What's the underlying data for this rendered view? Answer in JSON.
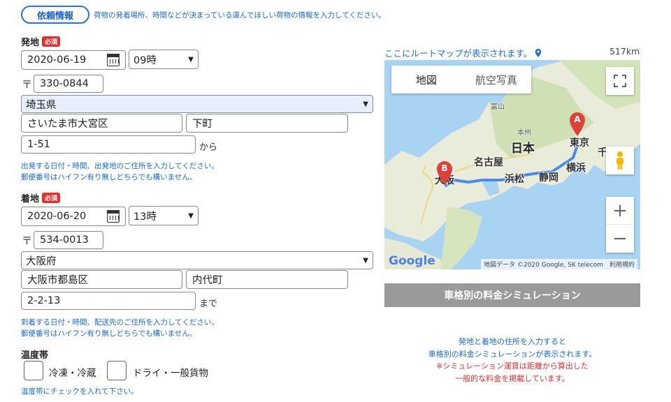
{
  "tab": {
    "label": "依頼情報"
  },
  "intro": "荷物の発着場所、時間などが決まっている運んでほしい荷物の情報を入力してください。",
  "required_badge": "必須",
  "postal_mark": "〒",
  "departure": {
    "label": "発地",
    "date": "2020-06-19",
    "time": "09時",
    "postal": "330-0844",
    "prefecture": "埼玉県",
    "city": "さいたま市大宮区",
    "town": "下町",
    "address": "1-51",
    "suffix": "から",
    "note1": "出発する日付・時間、出発地のご住所を入力してください。",
    "note2": "郵便番号はハイフン有り無しどちらでも構いません。"
  },
  "arrival": {
    "label": "着地",
    "date": "2020-06-20",
    "time": "13時",
    "postal": "534-0013",
    "prefecture": "大阪府",
    "city": "大阪市都島区",
    "town": "内代町",
    "address": "2-2-13",
    "suffix": "まで",
    "note1": "到着する日付・時間、配送先のご住所を入力してください。",
    "note2": "郵便番号はハイフン有り無しどちらでも構いません。"
  },
  "temperature": {
    "label": "温度帯",
    "option1": "冷凍・冷蔵",
    "option2": "ドライ・一般貨物",
    "note": "温度帯にチェックを入れて下さい。"
  },
  "map": {
    "caption": "ここにルートマップが表示されます。",
    "distance": "517km",
    "tab_map": "地図",
    "tab_satellite": "航空写真",
    "zoom_in": "+",
    "zoom_out": "−",
    "marker_a": "A",
    "marker_b": "B",
    "labels": {
      "japan": "日本",
      "tokyo": "東京",
      "yokohama": "横浜",
      "chiba": "千",
      "nagoya": "名古屋",
      "osaka": "大阪",
      "hamamatsu": "浜松",
      "shizuoka": "静岡",
      "toyama": "富山",
      "honshu": "本州"
    },
    "google": "Google",
    "footer": "地図データ ©2020 Google, SK telecom　利用規約"
  },
  "simulation": {
    "button": "車格別の料金シミュレーション",
    "line1": "発地と着地の住所を入力すると",
    "line2": "車格別の料金シミュレーションが表示されます。",
    "line3": "※シミュレーション運賃は距離から算出した",
    "line4": "一般的な料金を掲載しています。"
  },
  "colors": {
    "accent": "#1a6bd6",
    "required": "#e03030",
    "sim_button": "#9a9a9a",
    "map_sea": "#a9d3f2",
    "route": "#4a8ae8",
    "marker": "#e0403a"
  }
}
